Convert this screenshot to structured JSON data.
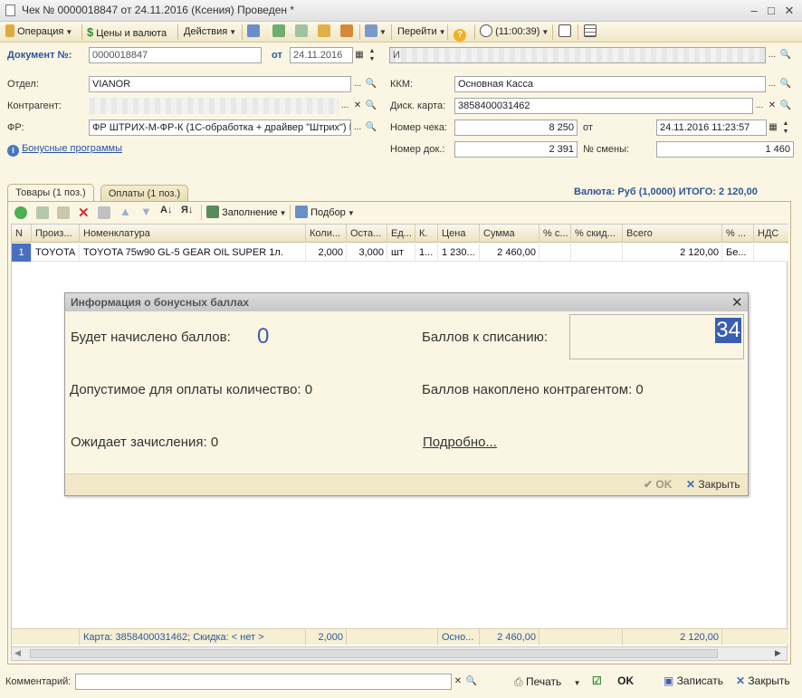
{
  "window": {
    "title": "Чек № 0000018847 от 24.11.2016 (Ксения) Проведен *"
  },
  "toolbar": {
    "operation": "Операция",
    "prices": "Цены и валюта",
    "actions": "Действия",
    "goto": "Перейти",
    "time": "(11:00:39)"
  },
  "header": {
    "doc_label": "Документ №:",
    "doc_number": "0000018847",
    "from_label": "от",
    "doc_date": "24.11.2016",
    "org_value": "И",
    "dept_label": "Отдел:",
    "dept_value": "VIANOR",
    "kkm_label": "ККМ:",
    "kkm_value": "Основная Касса",
    "counterparty_label": "Контрагент:",
    "card_label": "Диск. карта:",
    "card_value": "3858400031462",
    "fr_label": "ФР:",
    "fr_value": "ФР ШТРИХ-М-ФР-К (1С-обработка + драйвер \"Штрих\") N",
    "receipt_no_label": "Номер чека:",
    "receipt_no_value": "8 250",
    "receipt_from_label": "от",
    "receipt_date": "24.11.2016 11:23:57",
    "doc_no_label": "Номер док.:",
    "doc_no_value": "2 391",
    "shift_label": "№ смены:",
    "shift_value": "1 460",
    "bonus_link": "Бонусные программы"
  },
  "tabs": [
    {
      "label": "Товары (1 поз.)",
      "active": true
    },
    {
      "label": "Оплаты (1 поз.)",
      "active": false
    }
  ],
  "currency_summary": "Валюта: Руб (1,0000) ИТОГО: 2 120,00",
  "grid_toolbar": {
    "fill": "Заполнение",
    "pick": "Подбор"
  },
  "grid": {
    "columns": [
      "N",
      "Произ...",
      "Номенклатура",
      "Коли...",
      "Оста...",
      "Ед...",
      "К.",
      "Цена",
      "Сумма",
      "% с...",
      "% скид...",
      "Всего",
      "% ...",
      "НДС"
    ],
    "rows": [
      [
        "1",
        "TOYOTA",
        "TOYOTA 75w90 GL-5 GEAR OIL SUPER 1л.",
        "2,000",
        "3,000",
        "шт",
        "1...",
        "1 230...",
        "2 460,00",
        "",
        "",
        "2 120,00",
        "Бе...",
        ""
      ]
    ],
    "footer": {
      "card_info": "Карта: 3858400031462; Скидка: < нет >",
      "qty": "2,000",
      "price": "Осно...",
      "sum": "2 460,00",
      "total": "2 120,00"
    }
  },
  "dialog": {
    "title": "Информация о бонусных баллах",
    "accrue_label": "Будет начислено баллов:",
    "accrue_value": "0",
    "writeoff_label": "Баллов к списанию:",
    "writeoff_value": "34",
    "allowed_label": "Допустимое для оплаты количество: 0",
    "accumulated_label": "Баллов накоплено контрагентом: 0",
    "pending_label": "Ожидает зачисления: 0",
    "details_link": "Подробно...",
    "ok": "OK",
    "close": "Закрыть"
  },
  "bottom": {
    "comment_label": "Комментарий:",
    "print": "Печать",
    "ok": "OK",
    "save": "Записать",
    "close": "Закрыть"
  }
}
